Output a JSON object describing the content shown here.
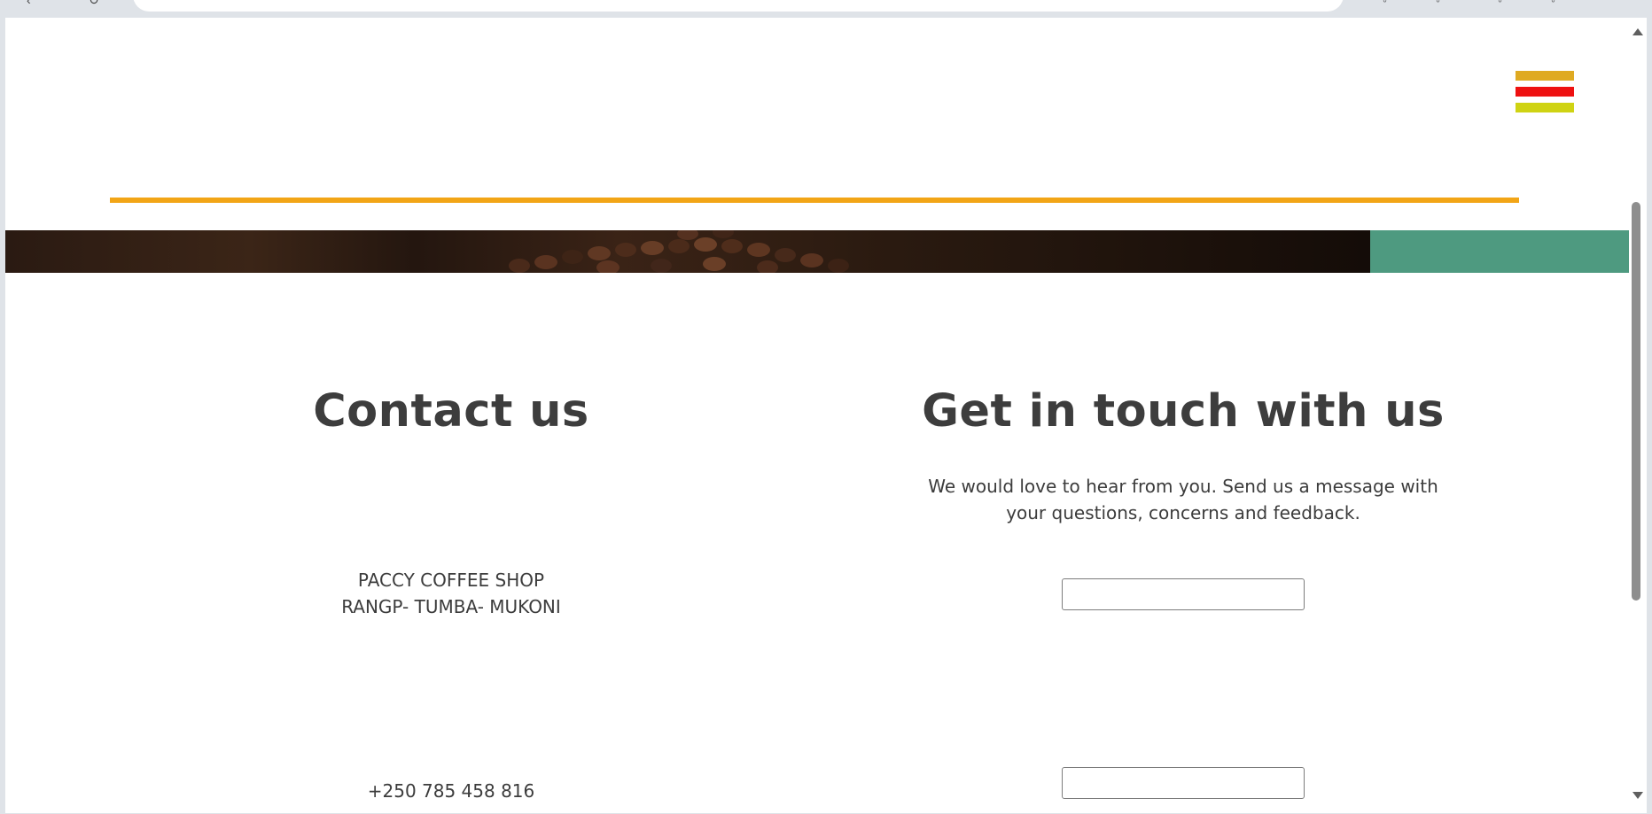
{
  "colors": {
    "menu_bar_1": "#dfaa22",
    "menu_bar_2": "#ee1111",
    "menu_bar_3": "#cfd313",
    "header_rule": "#f2a516",
    "hero_accent": "#4e9a80",
    "text": "#3c3c3c"
  },
  "icons": {
    "menu": "hamburger-menu-icon",
    "hero": "coffee-beans-image"
  },
  "contact": {
    "title": "Contact us",
    "address_line1": "PACCY COFFEE SHOP",
    "address_line2": "RANGP- TUMBA- MUKONI",
    "phone": "+250 785 458 816"
  },
  "touch": {
    "title": "Get in touch with us",
    "intro": "We would love to hear from you. Send us a message with your questions, concerns and feedback.",
    "field_1_value": "",
    "field_2_value": ""
  }
}
